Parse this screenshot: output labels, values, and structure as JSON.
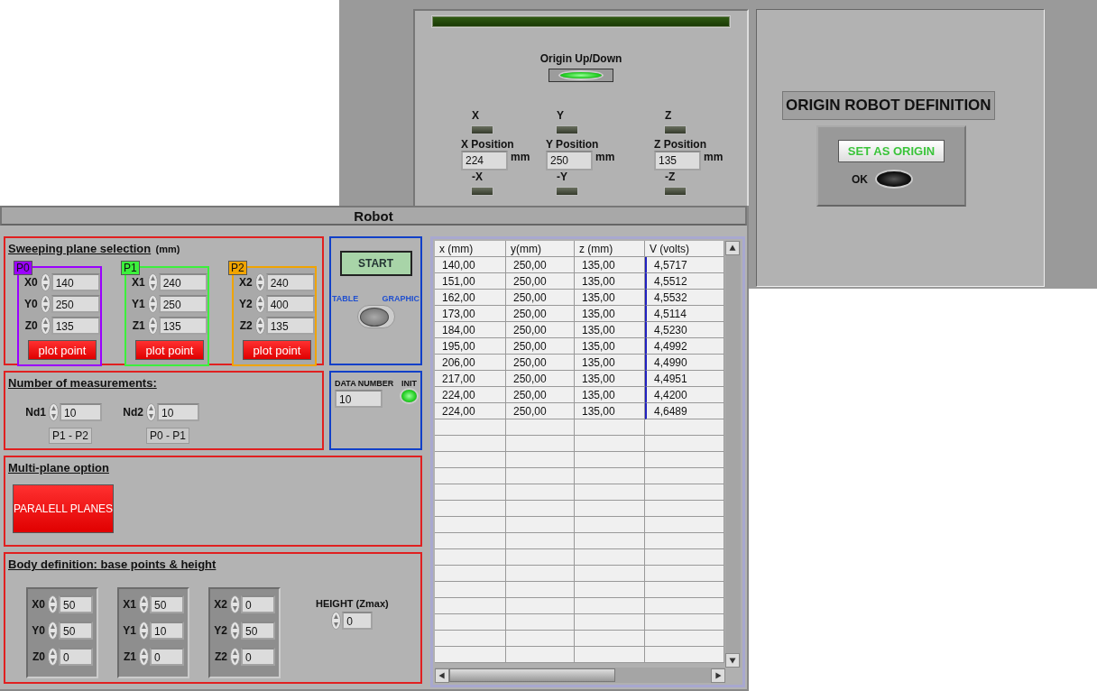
{
  "origin_panel": {
    "progress": {
      "level": 1
    },
    "up_down": {
      "label": "Origin Up/Down",
      "on": true
    },
    "axes": [
      {
        "label": "X",
        "on": false,
        "position_label": "X Position",
        "value": "224",
        "unit": "mm",
        "minus_label": "-X",
        "minus_on": false
      },
      {
        "label": "Y",
        "on": false,
        "position_label": "Y Position",
        "value": "250",
        "unit": "mm",
        "minus_label": "-Y",
        "minus_on": false
      },
      {
        "label": "Z",
        "on": false,
        "position_label": "Z Position",
        "value": "135",
        "unit": "mm",
        "minus_label": "-Z",
        "minus_on": false
      }
    ]
  },
  "origin_definition": {
    "title": "ORIGIN ROBOT DEFINITION",
    "button": "SET AS ORIGIN",
    "ok_label": "OK",
    "ok_on": false
  },
  "robot": {
    "title": "Robot",
    "sweeping": {
      "title": "Sweeping plane selection",
      "unit": "(mm)",
      "points": [
        {
          "tag": "P0",
          "color": "#9b00ff",
          "fields": [
            {
              "label": "X0",
              "value": "140"
            },
            {
              "label": "Y0",
              "value": "250"
            },
            {
              "label": "Z0",
              "value": "135"
            }
          ],
          "button": "plot point"
        },
        {
          "tag": "P1",
          "color": "#3cf03c",
          "fields": [
            {
              "label": "X1",
              "value": "240"
            },
            {
              "label": "Y1",
              "value": "250"
            },
            {
              "label": "Z1",
              "value": "135"
            }
          ],
          "button": "plot point"
        },
        {
          "tag": "P2",
          "color": "#f0a400",
          "fields": [
            {
              "label": "X2",
              "value": "240"
            },
            {
              "label": "Y2",
              "value": "400"
            },
            {
              "label": "Z2",
              "value": "135"
            }
          ],
          "button": "plot point"
        }
      ]
    },
    "measurements": {
      "title": "Number of measurements:",
      "counts": [
        {
          "label": "Nd1",
          "value": "10",
          "caption": "P1 - P2"
        },
        {
          "label": "Nd2",
          "value": "10",
          "caption": "P0 - P1"
        }
      ]
    },
    "multi_plane": {
      "title": "Multi-plane option",
      "button": "PARALELL PLANES"
    },
    "body": {
      "title": "Body definition: base points & height",
      "points": [
        [
          {
            "label": "X0",
            "value": "50"
          },
          {
            "label": "Y0",
            "value": "50"
          },
          {
            "label": "Z0",
            "value": "0"
          }
        ],
        [
          {
            "label": "X1",
            "value": "50"
          },
          {
            "label": "Y1",
            "value": "10"
          },
          {
            "label": "Z1",
            "value": "0"
          }
        ],
        [
          {
            "label": "X2",
            "value": "0"
          },
          {
            "label": "Y2",
            "value": "50"
          },
          {
            "label": "Z2",
            "value": "0"
          }
        ]
      ],
      "height": {
        "label": "HEIGHT (Zmax)",
        "value": "0"
      }
    },
    "start_button": "START",
    "toggle": {
      "left": "TABLE",
      "right": "GRAPHIC",
      "on": false
    },
    "data_number": {
      "label": "DATA NUMBER",
      "value": "10"
    },
    "init": {
      "label": "INIT",
      "on": true
    },
    "table": {
      "columns": [
        "x (mm)",
        "y(mm)",
        "z (mm)",
        "V (volts)"
      ],
      "rows": [
        [
          "140,00",
          "250,00",
          "135,00",
          "4,5717"
        ],
        [
          "151,00",
          "250,00",
          "135,00",
          "4,5512"
        ],
        [
          "162,00",
          "250,00",
          "135,00",
          "4,5532"
        ],
        [
          "173,00",
          "250,00",
          "135,00",
          "4,5114"
        ],
        [
          "184,00",
          "250,00",
          "135,00",
          "4,5230"
        ],
        [
          "195,00",
          "250,00",
          "135,00",
          "4,4992"
        ],
        [
          "206,00",
          "250,00",
          "135,00",
          "4,4990"
        ],
        [
          "217,00",
          "250,00",
          "135,00",
          "4,4951"
        ],
        [
          "224,00",
          "250,00",
          "135,00",
          "4,4200"
        ],
        [
          "224,00",
          "250,00",
          "135,00",
          "4,6489"
        ]
      ]
    }
  }
}
